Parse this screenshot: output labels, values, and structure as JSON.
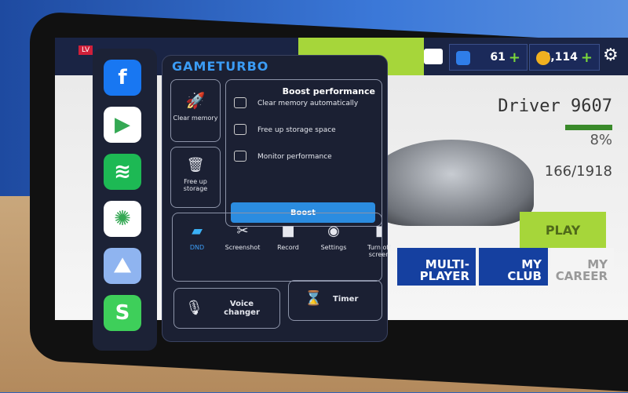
{
  "game": {
    "level_label": "LV",
    "gems": "61",
    "coins": "2,114",
    "player_name": "Driver 9607",
    "progress_percent": "8%",
    "score": "166/1918",
    "play": "PLAY",
    "nav": [
      {
        "top": "MULTI-",
        "bottom": "PLAYER"
      },
      {
        "top": "MY",
        "bottom": "CLUB"
      },
      {
        "top": "MY",
        "bottom": "CAREER"
      }
    ]
  },
  "sidebar": {
    "apps": [
      {
        "name": "facebook-icon",
        "glyph": "f",
        "bg": "#1877f2"
      },
      {
        "name": "google-play-icon",
        "glyph": "▶",
        "bg": "#ffffff"
      },
      {
        "name": "spotify-icon",
        "glyph": "≋",
        "bg": "#1db954"
      },
      {
        "name": "google-photos-icon",
        "glyph": "✺",
        "bg": "#ffffff"
      },
      {
        "name": "gallery-icon",
        "glyph": "⛰",
        "bg": "#8fb4f0"
      },
      {
        "name": "shortcut-app-icon",
        "glyph": "S",
        "bg": "#3ecf5a"
      }
    ]
  },
  "gameturbo": {
    "logo": "GAMETURBO",
    "clear_memory": "Clear memory",
    "free_up_storage": "Free up storage",
    "boost_title": "Boost performance",
    "options": [
      "Clear memory automatically",
      "Free up storage space",
      "Monitor performance"
    ],
    "boost_button": "Boost",
    "tools": [
      {
        "label": "DND",
        "icon": "chat-bubble-icon",
        "glyph": "▰"
      },
      {
        "label": "Screenshot",
        "icon": "scissors-icon",
        "glyph": "✂"
      },
      {
        "label": "Record",
        "icon": "video-camera-icon",
        "glyph": "■"
      },
      {
        "label": "Settings",
        "icon": "settings-icon",
        "glyph": "◉"
      },
      {
        "label": "Turn off screen",
        "icon": "lock-icon",
        "glyph": "▮"
      }
    ],
    "voice_changer": "Voice changer",
    "timer": "Timer"
  },
  "colors": {
    "accent": "#3b9cf5",
    "lime": "#a6d63a",
    "panel": "#1b2033"
  }
}
